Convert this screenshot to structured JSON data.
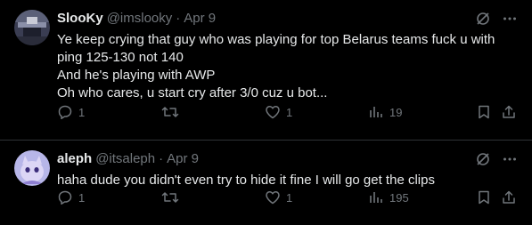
{
  "tweets": [
    {
      "name": "SlooKy",
      "handle": "@imslooky",
      "separator": "·",
      "date": "Apr 9",
      "lines": [
        "Ye keep crying that guy who was playing for top Belarus teams fuck u with",
        "ping 125-130 not 140",
        "And he's playing with AWP",
        "Oh who cares, u start cry after 3/0 cuz u bot..."
      ],
      "replies": "1",
      "retweets": "",
      "likes": "1",
      "views": "19"
    },
    {
      "name": "aleph",
      "handle": "@itsaleph",
      "separator": "·",
      "date": "Apr 9",
      "lines": [
        "haha dude you didn't even try to hide it fine I will go get the clips"
      ],
      "replies": "1",
      "retweets": "",
      "likes": "1",
      "views": "195"
    }
  ],
  "icons": [
    "grok-icon",
    "more-icon",
    "reply-icon",
    "retweet-icon",
    "like-icon",
    "views-icon",
    "bookmark-icon",
    "share-icon"
  ],
  "colors": {
    "background": "#000000",
    "text": "#e7e9ea",
    "muted": "#71767b",
    "divider": "#2f3336"
  }
}
